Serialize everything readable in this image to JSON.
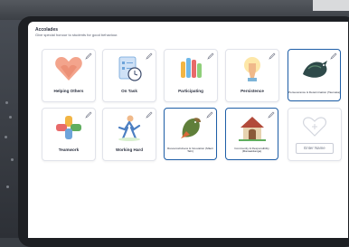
{
  "page": {
    "title": "Accolades",
    "subtitle": "Give special honour to students for good behaviour."
  },
  "cards": [
    {
      "label": "Helping Others"
    },
    {
      "label": "On Task"
    },
    {
      "label": "Participating"
    },
    {
      "label": "Persistence"
    },
    {
      "label": "Perseverance & Determination (Taumata)"
    },
    {
      "label": "Teamwork"
    },
    {
      "label": "Working Hard"
    },
    {
      "label": "Resourcefulness & Innovation (Māori Tahi)"
    },
    {
      "label": "Community & Responsibility (Manaakitanga)"
    }
  ],
  "add_card": {
    "placeholder": "Enter Name"
  },
  "colors": {
    "selected_border": "#1f5fa8",
    "screen_bg": "#ffffff"
  }
}
